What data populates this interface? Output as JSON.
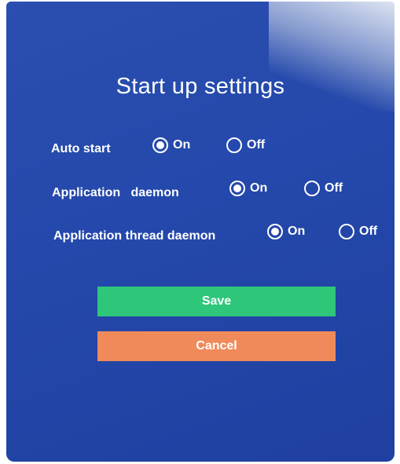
{
  "title": "Start up settings",
  "rows": [
    {
      "label": "Auto start",
      "on": "On",
      "off": "Off",
      "selected": "on"
    },
    {
      "label": "Application   daemon",
      "on": "On",
      "off": "Off",
      "selected": "on"
    },
    {
      "label": "Application thread daemon",
      "on": "On",
      "off": "Off",
      "selected": "on"
    }
  ],
  "buttons": {
    "save": "Save",
    "cancel": "Cancel"
  },
  "colors": {
    "background": "#2448ab",
    "save": "#2ec77a",
    "cancel": "#f08a5a"
  }
}
